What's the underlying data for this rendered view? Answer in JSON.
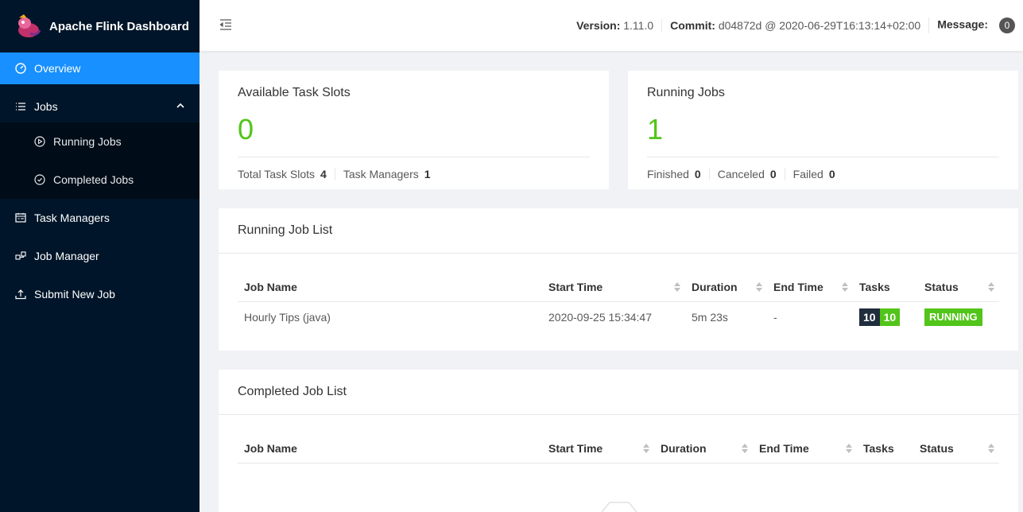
{
  "app": {
    "title": "Apache Flink Dashboard"
  },
  "sidebar": {
    "overview": "Overview",
    "jobs": "Jobs",
    "running_jobs": "Running Jobs",
    "completed_jobs": "Completed Jobs",
    "task_managers": "Task Managers",
    "job_manager": "Job Manager",
    "submit_job": "Submit New Job"
  },
  "header": {
    "version_label": "Version:",
    "version": "1.11.0",
    "commit_label": "Commit:",
    "commit": "d04872d @ 2020-06-29T16:13:14+02:00",
    "message_label": "Message:",
    "message_count": "0"
  },
  "slots": {
    "title": "Available Task Slots",
    "value": "0",
    "total_label": "Total Task Slots",
    "total": "4",
    "tm_label": "Task Managers",
    "tm": "1"
  },
  "running": {
    "title": "Running Jobs",
    "value": "1",
    "finished_label": "Finished",
    "finished": "0",
    "canceled_label": "Canceled",
    "canceled": "0",
    "failed_label": "Failed",
    "failed": "0"
  },
  "running_list": {
    "title": "Running Job List",
    "columns": [
      "Job Name",
      "Start Time",
      "Duration",
      "End Time",
      "Tasks",
      "Status"
    ],
    "rows": [
      {
        "name": "Hourly Tips (java)",
        "start": "2020-09-25 15:34:47",
        "duration": "5m 23s",
        "end": "-",
        "tasks_total": "10",
        "tasks_running": "10",
        "status": "RUNNING"
      }
    ]
  },
  "completed_list": {
    "title": "Completed Job List",
    "columns": [
      "Job Name",
      "Start Time",
      "Duration",
      "End Time",
      "Tasks",
      "Status"
    ]
  },
  "colors": {
    "sidebar": "#001529",
    "active": "#1890ff",
    "accent_green": "#52c41a",
    "tag_dark": "#1f2d3d"
  }
}
